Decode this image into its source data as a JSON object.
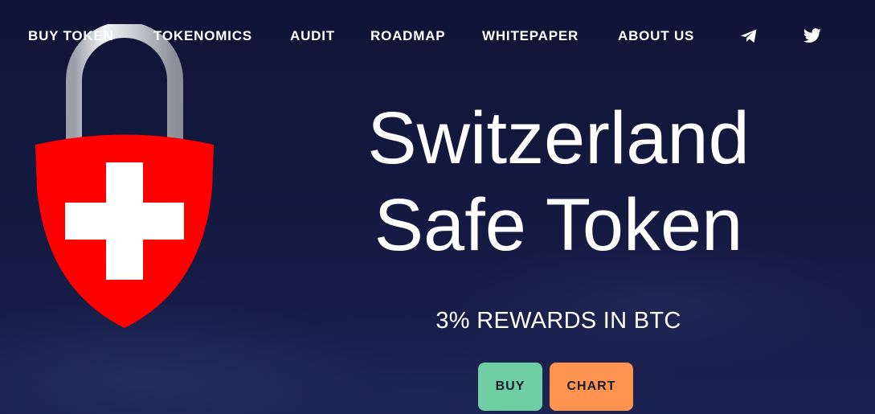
{
  "nav": {
    "items": [
      {
        "label": "BUY TOKEN"
      },
      {
        "label": "TOKENOMICS"
      },
      {
        "label": "AUDIT"
      },
      {
        "label": "ROADMAP"
      },
      {
        "label": "WHITEPAPER"
      },
      {
        "label": "ABOUT US"
      }
    ],
    "social": [
      {
        "icon": "telegram-icon"
      },
      {
        "icon": "twitter-icon"
      }
    ]
  },
  "logo": {
    "icon": "swiss-padlock-logo",
    "shield_color": "#ff0000",
    "cross_color": "#ffffff"
  },
  "hero": {
    "title_line1": "Switzerland",
    "title_line2": "Safe Token",
    "subtitle": "3% REWARDS IN BTC",
    "buy_label": "BUY",
    "chart_label": "CHART"
  },
  "colors": {
    "background": "#12163a",
    "buy_button": "#6ecfa2",
    "chart_button": "#ff9350"
  }
}
